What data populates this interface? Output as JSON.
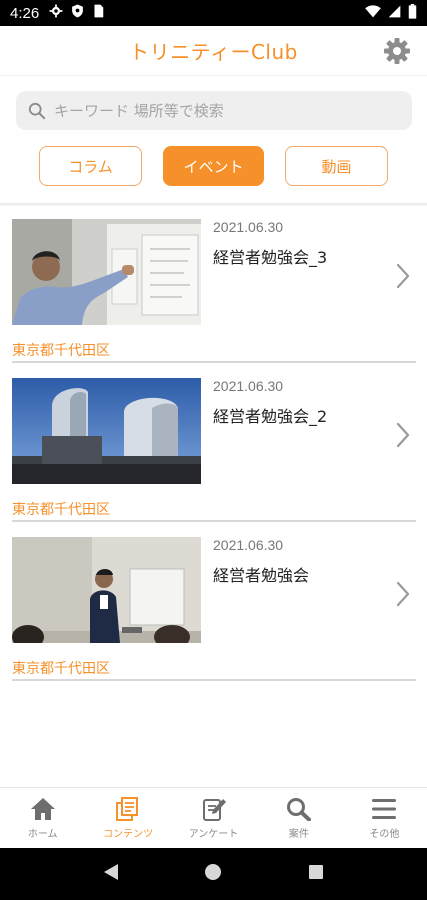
{
  "status_bar": {
    "time": "4:26"
  },
  "header": {
    "title": "トリニティーClub"
  },
  "search": {
    "placeholder": "キーワード 場所等で検索"
  },
  "segments": [
    {
      "label": "コラム",
      "active": false
    },
    {
      "label": "イベント",
      "active": true
    },
    {
      "label": "動画",
      "active": false
    }
  ],
  "items": [
    {
      "date": "2021.06.30",
      "title": "経営者勉強会_3",
      "location": "東京都千代田区",
      "image": "man-at-whiteboard-photo"
    },
    {
      "date": "2021.06.30",
      "title": "経営者勉強会_2",
      "location": "東京都千代田区",
      "image": "city-towers-photo"
    },
    {
      "date": "2021.06.30",
      "title": "経営者勉強会",
      "location": "東京都千代田区",
      "image": "seminar-room-photo"
    }
  ],
  "bottom_nav": [
    {
      "label": "ホーム",
      "icon": "home-icon"
    },
    {
      "label": "コンテンツ",
      "icon": "contents-icon"
    },
    {
      "label": "アンケート",
      "icon": "survey-icon"
    },
    {
      "label": "案件",
      "icon": "search-cases-icon"
    },
    {
      "label": "その他",
      "icon": "menu-icon"
    }
  ],
  "colors": {
    "accent": "#f5902a",
    "text": "#222222",
    "muted": "#8a8a8a"
  }
}
